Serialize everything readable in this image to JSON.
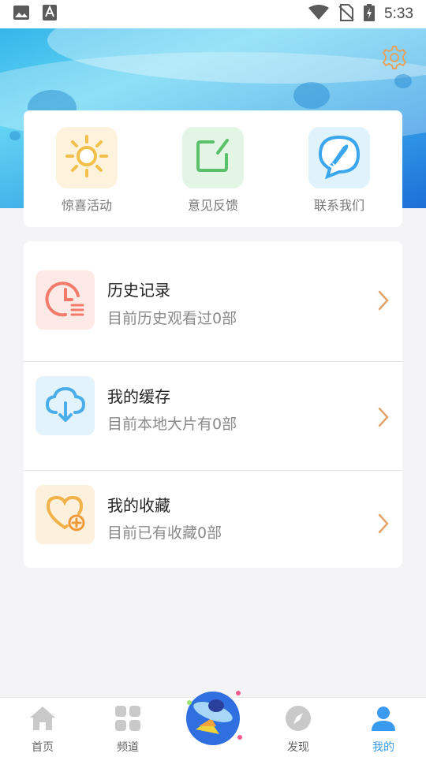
{
  "status_bar": {
    "time": "5:33",
    "left_icons": [
      "image-icon",
      "font-a-icon"
    ],
    "right_icons": [
      "wifi-icon",
      "no-sim-icon",
      "battery-charging-icon"
    ]
  },
  "colors": {
    "accent": "#3a9af0",
    "chevron": "#e0a46a",
    "page_bg": "#f4f4f6"
  },
  "quick_actions": [
    {
      "label": "惊喜活动",
      "icon": "sun-icon",
      "bg": "#fdf2dc"
    },
    {
      "label": "意见反馈",
      "icon": "feedback-edit-icon",
      "bg": "#e3f6e6"
    },
    {
      "label": "联系我们",
      "icon": "rocket-chat-icon",
      "bg": "#e0f2fc"
    }
  ],
  "list": [
    {
      "title": "历史记录",
      "subtitle": "目前历史观看过0部",
      "icon": "clock-history-icon",
      "bg": "#fde9e6"
    },
    {
      "title": "我的缓存",
      "subtitle": "目前本地大片有0部",
      "icon": "cloud-download-icon",
      "bg": "#e3f3fc"
    },
    {
      "title": "我的收藏",
      "subtitle": "目前已有收藏0部",
      "icon": "heart-add-icon",
      "bg": "#fdf0dc"
    }
  ],
  "nav": {
    "items": [
      {
        "label": "首页",
        "icon": "home-icon",
        "active": false
      },
      {
        "label": "频道",
        "icon": "grid-icon",
        "active": false
      },
      {
        "label": "发现",
        "icon": "compass-icon",
        "active": false
      },
      {
        "label": "我的",
        "icon": "user-icon",
        "active": true
      }
    ]
  }
}
